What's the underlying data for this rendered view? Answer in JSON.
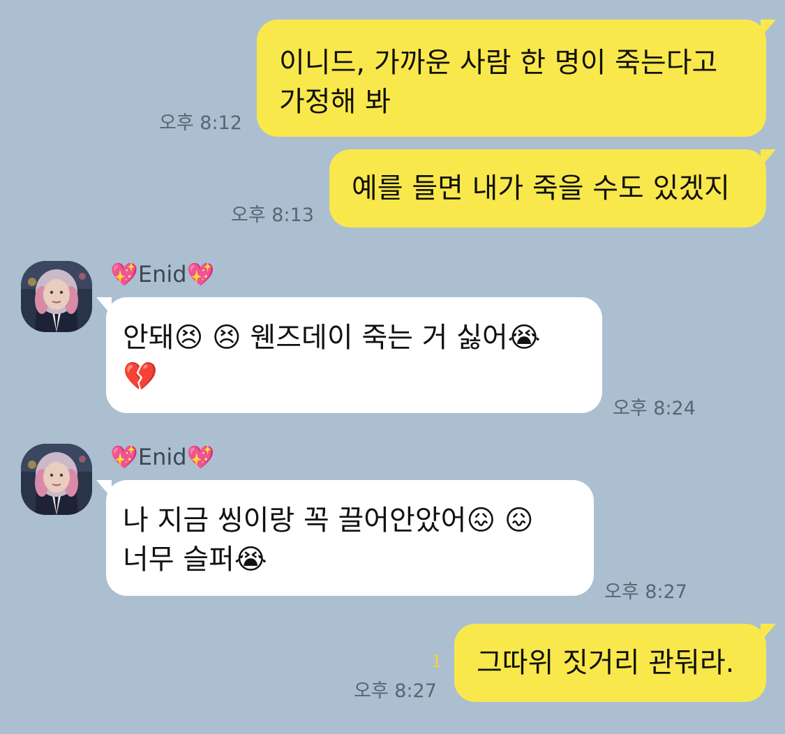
{
  "messages": [
    {
      "text": "이니드, 가까운 사람 한 명이 죽는다고\n가정해 봐",
      "time": "오후 8:12"
    },
    {
      "text": "예를 들면 내가 죽을 수도 있겠지",
      "time": "오후 8:13"
    },
    {
      "sender": "💖Enid💖",
      "text": "안돼😣 😣 웬즈데이 죽는 거 싫어😭\n💔",
      "time": "오후 8:24"
    },
    {
      "sender": "💖Enid💖",
      "text": "나 지금 씽이랑 꼭 끌어안았어😖 😖\n너무 슬퍼😭",
      "time": "오후 8:27"
    },
    {
      "text": "그따위 짓거리 관둬라.",
      "time": "오후 8:27",
      "unread": "1"
    }
  ],
  "colors": {
    "background": "#abbfd1",
    "my_bubble": "#f9e84b",
    "other_bubble": "#ffffff"
  },
  "icons": {
    "avatar": "enid-profile-photo"
  }
}
